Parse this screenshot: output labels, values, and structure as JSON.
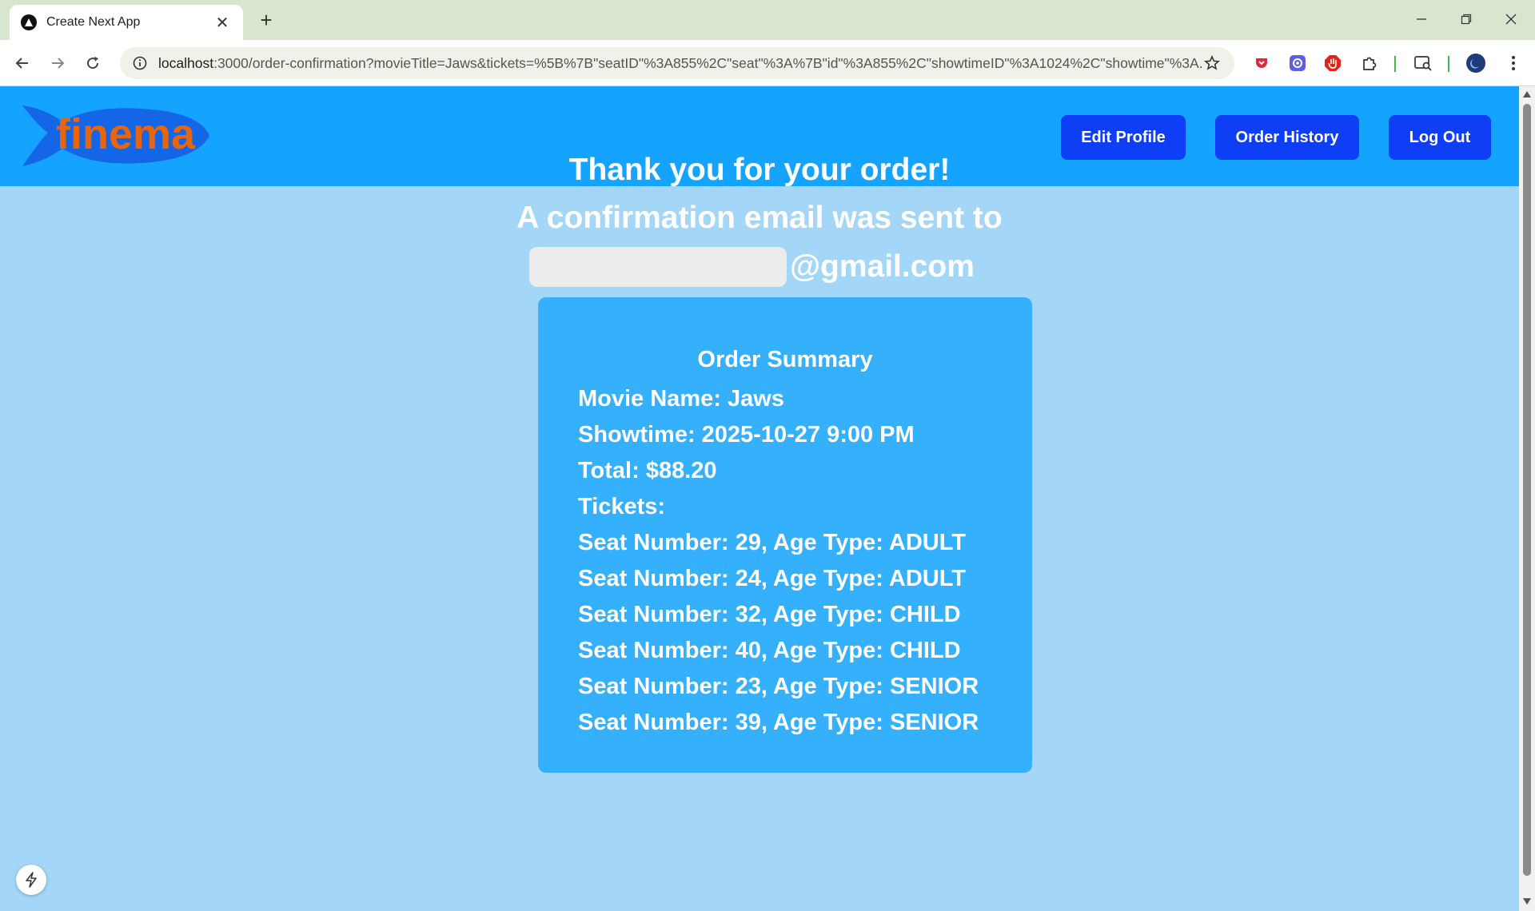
{
  "browser": {
    "tab": {
      "title": "Create Next App",
      "close": "✕"
    },
    "new_tab": "+",
    "url_host": "localhost",
    "url_rest": ":3000/order-confirmation?movieTitle=Jaws&tickets=%5B%7B\"seatID\"%3A855%2C\"seat\"%3A%7B\"id\"%3A855%2C\"showtimeID\"%3A1024%2C\"showtime\"%3A..."
  },
  "header": {
    "logo_text": "finema",
    "nav": {
      "edit_profile": "Edit Profile",
      "order_history": "Order History",
      "log_out": "Log Out"
    }
  },
  "confirmation": {
    "thank_you": "Thank you for your order!",
    "email_notice": "A confirmation email was sent to",
    "email_domain": "@gmail.com"
  },
  "order_summary": {
    "title": "Order Summary",
    "movie_line": "Movie Name: Jaws",
    "showtime_line": "Showtime: 2025-10-27 9:00 PM",
    "total_line": "Total: $88.20",
    "tickets_label": "Tickets:",
    "tickets": [
      "Seat Number: 29, Age Type: ADULT",
      "Seat Number: 24, Age Type: ADULT",
      "Seat Number: 32, Age Type: CHILD",
      "Seat Number: 40, Age Type: CHILD",
      "Seat Number: 23, Age Type: SENIOR",
      "Seat Number: 39, Age Type: SENIOR"
    ]
  },
  "colors": {
    "header_bg": "#14a3fe",
    "page_bg": "#a3d6f7",
    "card_bg": "#35b0fc",
    "button_bg": "#0f3ef7",
    "logo_fish": "#1466e6",
    "logo_text": "#e8650c"
  }
}
